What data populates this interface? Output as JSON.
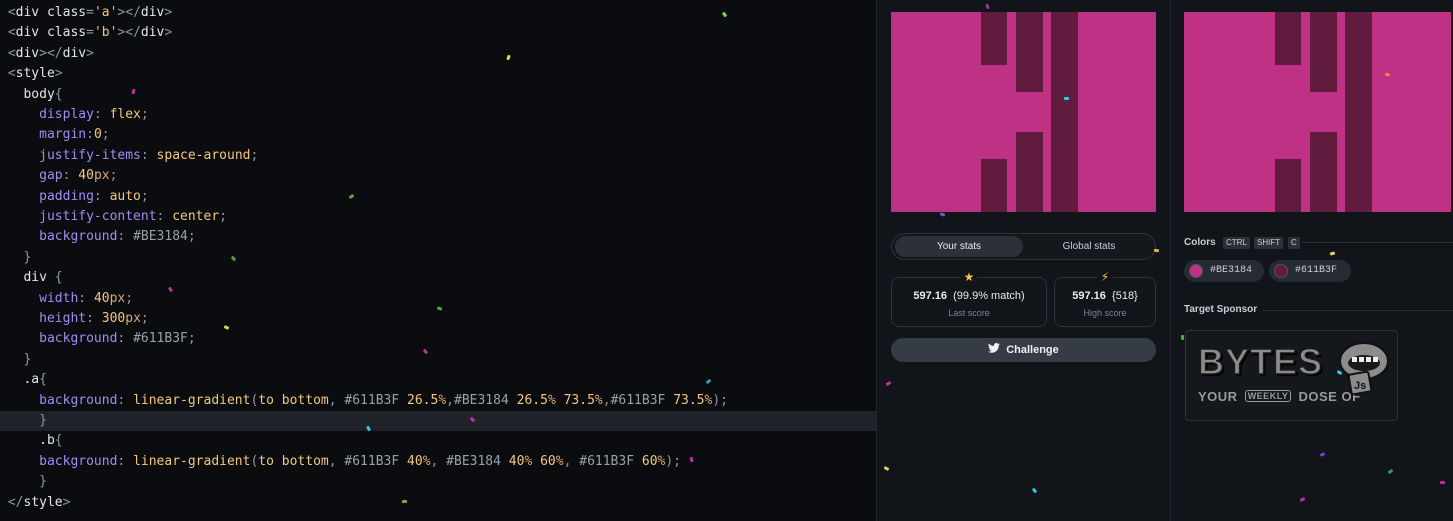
{
  "editor": {
    "lines": [
      [
        [
          "tok-plain",
          "<"
        ],
        [
          "tok-tag",
          "div"
        ],
        [
          "tok-plain",
          " "
        ],
        [
          "tok-tag",
          "class"
        ],
        [
          "tok-plain",
          "="
        ],
        [
          "tok-str",
          "'a'"
        ],
        [
          "tok-plain",
          "></"
        ],
        [
          "tok-tag",
          "div"
        ],
        [
          "tok-plain",
          ">"
        ]
      ],
      [
        [
          "tok-plain",
          "<"
        ],
        [
          "tok-tag",
          "div"
        ],
        [
          "tok-plain",
          " "
        ],
        [
          "tok-tag",
          "class"
        ],
        [
          "tok-plain",
          "="
        ],
        [
          "tok-str",
          "'b'"
        ],
        [
          "tok-plain",
          "></"
        ],
        [
          "tok-tag",
          "div"
        ],
        [
          "tok-plain",
          ">"
        ]
      ],
      [
        [
          "tok-plain",
          "<"
        ],
        [
          "tok-tag",
          "div"
        ],
        [
          "tok-plain",
          "></"
        ],
        [
          "tok-tag",
          "div"
        ],
        [
          "tok-plain",
          ">"
        ]
      ],
      [
        [
          "tok-plain",
          "<"
        ],
        [
          "tok-tag",
          "style"
        ],
        [
          "tok-plain",
          ">"
        ]
      ],
      [
        [
          "tok-sel",
          "  body"
        ],
        [
          "tok-plain",
          "{"
        ]
      ],
      [
        [
          "tok-prop",
          "    display"
        ],
        [
          "tok-plain",
          ": "
        ],
        [
          "tok-val",
          "flex"
        ],
        [
          "tok-plain",
          ";"
        ]
      ],
      [
        [
          "tok-prop",
          "    margin"
        ],
        [
          "tok-plain",
          ":"
        ],
        [
          "tok-val",
          "0"
        ],
        [
          "tok-plain",
          ";"
        ]
      ],
      [
        [
          "tok-prop",
          "    justify-items"
        ],
        [
          "tok-plain",
          ": "
        ],
        [
          "tok-val",
          "space-around"
        ],
        [
          "tok-plain",
          ";"
        ]
      ],
      [
        [
          "tok-prop",
          "    gap"
        ],
        [
          "tok-plain",
          ": "
        ],
        [
          "tok-val",
          "40"
        ],
        [
          "tok-unit",
          "px"
        ],
        [
          "tok-plain",
          ";"
        ]
      ],
      [
        [
          "tok-prop",
          "    padding"
        ],
        [
          "tok-plain",
          ": "
        ],
        [
          "tok-val",
          "auto"
        ],
        [
          "tok-plain",
          ";"
        ]
      ],
      [
        [
          "tok-prop",
          "    justify-content"
        ],
        [
          "tok-plain",
          ": "
        ],
        [
          "tok-val",
          "center"
        ],
        [
          "tok-plain",
          ";"
        ]
      ],
      [
        [
          "tok-prop",
          "    background"
        ],
        [
          "tok-plain",
          ": "
        ],
        [
          "tok-hex",
          "#BE3184"
        ],
        [
          "tok-plain",
          ";"
        ]
      ],
      [
        [
          "tok-plain",
          "  }"
        ]
      ],
      [
        [
          "tok-sel",
          "  div"
        ],
        [
          "tok-plain",
          " {"
        ]
      ],
      [
        [
          "tok-prop",
          "    width"
        ],
        [
          "tok-plain",
          ": "
        ],
        [
          "tok-val",
          "40"
        ],
        [
          "tok-unit",
          "px"
        ],
        [
          "tok-plain",
          ";"
        ]
      ],
      [
        [
          "tok-prop",
          "    height"
        ],
        [
          "tok-plain",
          ": "
        ],
        [
          "tok-val",
          "300"
        ],
        [
          "tok-unit",
          "px"
        ],
        [
          "tok-plain",
          ";"
        ]
      ],
      [
        [
          "tok-prop",
          "    background"
        ],
        [
          "tok-plain",
          ": "
        ],
        [
          "tok-hex",
          "#611B3F"
        ],
        [
          "tok-plain",
          ";"
        ]
      ],
      [
        [
          "tok-plain",
          "  }"
        ]
      ],
      [
        [
          "tok-sel",
          "  .a"
        ],
        [
          "tok-plain",
          "{"
        ]
      ],
      [
        [
          "tok-prop",
          "    background"
        ],
        [
          "tok-plain",
          ": "
        ],
        [
          "tok-val",
          "linear-gradient"
        ],
        [
          "tok-plain",
          "("
        ],
        [
          "tok-val",
          "to bottom"
        ],
        [
          "tok-plain",
          ", "
        ],
        [
          "tok-hex",
          "#611B3F"
        ],
        [
          "tok-plain",
          " "
        ],
        [
          "tok-val",
          "26.5"
        ],
        [
          "tok-unit",
          "%"
        ],
        [
          "tok-plain",
          ","
        ],
        [
          "tok-hex",
          "#BE3184"
        ],
        [
          "tok-plain",
          " "
        ],
        [
          "tok-val",
          "26.5"
        ],
        [
          "tok-unit",
          "%"
        ],
        [
          "tok-plain",
          " "
        ],
        [
          "tok-val",
          "73.5"
        ],
        [
          "tok-unit",
          "%"
        ],
        [
          "tok-plain",
          ","
        ],
        [
          "tok-hex",
          "#611B3F"
        ],
        [
          "tok-plain",
          " "
        ],
        [
          "tok-val",
          "73.5"
        ],
        [
          "tok-unit",
          "%"
        ],
        [
          "tok-plain",
          ");"
        ]
      ],
      [
        [
          "tok-plain",
          "    }"
        ]
      ],
      [
        [
          "tok-sel",
          "    .b"
        ],
        [
          "tok-plain",
          "{"
        ]
      ],
      [
        [
          "tok-prop",
          "    background"
        ],
        [
          "tok-plain",
          ": "
        ],
        [
          "tok-val",
          "linear-gradient"
        ],
        [
          "tok-plain",
          "("
        ],
        [
          "tok-val",
          "to bottom"
        ],
        [
          "tok-plain",
          ", "
        ],
        [
          "tok-hex",
          "#611B3F"
        ],
        [
          "tok-plain",
          " "
        ],
        [
          "tok-val",
          "40"
        ],
        [
          "tok-unit",
          "%"
        ],
        [
          "tok-plain",
          ", "
        ],
        [
          "tok-hex",
          "#BE3184"
        ],
        [
          "tok-plain",
          " "
        ],
        [
          "tok-val",
          "40"
        ],
        [
          "tok-unit",
          "%"
        ],
        [
          "tok-plain",
          " "
        ],
        [
          "tok-val",
          "60"
        ],
        [
          "tok-unit",
          "%"
        ],
        [
          "tok-plain",
          ", "
        ],
        [
          "tok-hex",
          "#611B3F"
        ],
        [
          "tok-plain",
          " "
        ],
        [
          "tok-val",
          "60"
        ],
        [
          "tok-unit",
          "%"
        ],
        [
          "tok-plain",
          ");"
        ]
      ],
      [
        [
          "tok-plain",
          "    }"
        ]
      ],
      [
        [
          "tok-plain",
          "</"
        ],
        [
          "tok-tag",
          "style"
        ],
        [
          "tok-plain",
          ">"
        ]
      ]
    ],
    "active_line": 20
  },
  "stats": {
    "your_stats": "Your stats",
    "global_stats": "Global stats",
    "star_icon": "star-icon",
    "bolt_icon": "bolt-icon",
    "last_score_value": "597.16",
    "last_score_match": "(99.9% match)",
    "last_score_label": "Last score",
    "high_score_value": "597.16",
    "high_score_count": "{518}",
    "high_score_label": "High score",
    "challenge_label": "Challenge"
  },
  "colors": {
    "title": "Colors",
    "shortcut_keys": [
      "CTRL",
      "SHIFT",
      "C"
    ],
    "swatches": [
      {
        "hex": "#BE3184"
      },
      {
        "hex": "#611B3F"
      }
    ],
    "bg": "#BE3184",
    "fg": "#611B3F"
  },
  "sponsor": {
    "title": "Target Sponsor",
    "logo_text": "BYTES",
    "tagline_left": "YOUR",
    "tagline_mid": "WEEKLY",
    "tagline_right": "DOSE OF",
    "js_badge": "Js"
  }
}
